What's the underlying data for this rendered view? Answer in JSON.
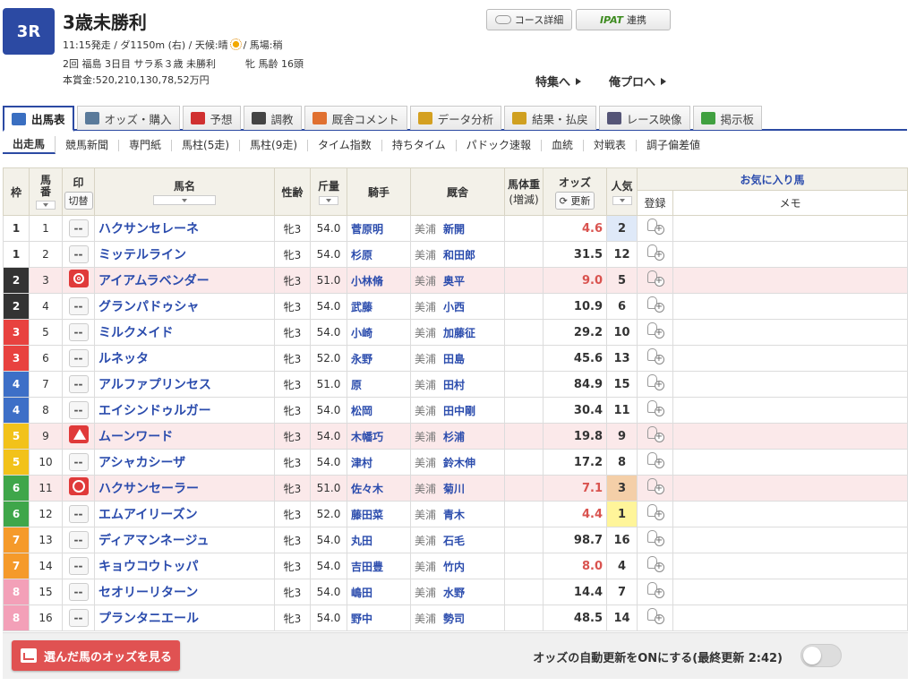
{
  "race": {
    "number": "3R",
    "title": "3歳未勝利",
    "info1_pre": "11:15発走 / ダ1150m (右) / 天候:晴",
    "info1_post": "/ 馬場:稍",
    "info2": "2回 福島 3日目 サラ系３歳 未勝利　　　牝 馬齢 16頭",
    "info3": "本賞金:520,210,130,78,52万円"
  },
  "header_buttons": {
    "course": "コース詳細",
    "ipat_logo": "IPAT",
    "ipat": "連携",
    "tokushu": "特集へ",
    "oreypro": "俺プロへ"
  },
  "tabs": [
    {
      "label": "出馬表",
      "icon": "table-icon",
      "color": "#3a6fc1"
    },
    {
      "label": "オッズ・購入",
      "icon": "odds-icon",
      "color": "#5a7a9a"
    },
    {
      "label": "予想",
      "icon": "target-icon",
      "color": "#d03030"
    },
    {
      "label": "調教",
      "icon": "stopwatch-icon",
      "color": "#444444"
    },
    {
      "label": "厩舎コメント",
      "icon": "barn-icon",
      "color": "#e07030"
    },
    {
      "label": "データ分析",
      "icon": "bar-chart-icon",
      "color": "#d4a020"
    },
    {
      "label": "結果・払戻",
      "icon": "coins-icon",
      "color": "#d0a020"
    },
    {
      "label": "レース映像",
      "icon": "video-icon",
      "color": "#555577"
    },
    {
      "label": "掲示板",
      "icon": "chat-icon",
      "color": "#40a040"
    }
  ],
  "subnav": [
    "出走馬",
    "競馬新聞",
    "専門紙",
    "馬柱(5走)",
    "馬柱(9走)",
    "タイム指数",
    "持ちタイム",
    "パドック速報",
    "血統",
    "対戦表",
    "調子偏差値"
  ],
  "columns": {
    "waku": "枠",
    "umaban": "馬番",
    "mark": "印",
    "mark_toggle": "切替",
    "name": "馬名",
    "sexage": "性齢",
    "weight": "斤量",
    "jockey": "騎手",
    "stable": "厩舎",
    "body": "馬体重",
    "body_sub": "(増減)",
    "odds": "オッズ",
    "odds_refresh": "更新",
    "ninki": "人気",
    "favorite": "お気に入り馬",
    "register": "登録",
    "memo": "メモ"
  },
  "waku_colors": {
    "1": {
      "bg": "#ffffff",
      "fg": "#333333"
    },
    "2": {
      "bg": "#333333",
      "fg": "#ffffff"
    },
    "3": {
      "bg": "#e8423f",
      "fg": "#ffffff"
    },
    "4": {
      "bg": "#3d6fc7",
      "fg": "#ffffff"
    },
    "5": {
      "bg": "#f2c21a",
      "fg": "#ffffff"
    },
    "6": {
      "bg": "#3fa64a",
      "fg": "#ffffff"
    },
    "7": {
      "bg": "#f59a2a",
      "fg": "#ffffff"
    },
    "8": {
      "bg": "#f3a0b8",
      "fg": "#ffffff"
    }
  },
  "horses": [
    {
      "waku": "1",
      "umaban": "1",
      "mark": "--",
      "name": "ハクサンセレーネ",
      "sexage": "牝3",
      "weight": "54.0",
      "jockey": "菅原明",
      "loc": "美浦",
      "trainer": "新開",
      "odds": "4.6",
      "hot": true,
      "ninki": "2",
      "highlight": false
    },
    {
      "waku": "1",
      "umaban": "2",
      "mark": "--",
      "name": "ミッテルライン",
      "sexage": "牝3",
      "weight": "54.0",
      "jockey": "杉原",
      "loc": "美浦",
      "trainer": "和田郎",
      "odds": "31.5",
      "hot": false,
      "ninki": "12",
      "highlight": false
    },
    {
      "waku": "2",
      "umaban": "3",
      "mark": "◎",
      "name": "アイアムラベンダー",
      "sexage": "牝3",
      "weight": "51.0",
      "jockey": "小林脩",
      "loc": "美浦",
      "trainer": "奥平",
      "odds": "9.0",
      "hot": true,
      "ninki": "5",
      "highlight": true
    },
    {
      "waku": "2",
      "umaban": "4",
      "mark": "--",
      "name": "グランパドゥシャ",
      "sexage": "牝3",
      "weight": "54.0",
      "jockey": "武藤",
      "loc": "美浦",
      "trainer": "小西",
      "odds": "10.9",
      "hot": false,
      "ninki": "6",
      "highlight": false
    },
    {
      "waku": "3",
      "umaban": "5",
      "mark": "--",
      "name": "ミルクメイド",
      "sexage": "牝3",
      "weight": "54.0",
      "jockey": "小崎",
      "loc": "美浦",
      "trainer": "加藤征",
      "odds": "29.2",
      "hot": false,
      "ninki": "10",
      "highlight": false
    },
    {
      "waku": "3",
      "umaban": "6",
      "mark": "--",
      "name": "ルネッタ",
      "sexage": "牝3",
      "weight": "52.0",
      "jockey": "永野",
      "loc": "美浦",
      "trainer": "田島",
      "odds": "45.6",
      "hot": false,
      "ninki": "13",
      "highlight": false
    },
    {
      "waku": "4",
      "umaban": "7",
      "mark": "--",
      "name": "アルファプリンセス",
      "sexage": "牝3",
      "weight": "51.0",
      "jockey": "原",
      "loc": "美浦",
      "trainer": "田村",
      "odds": "84.9",
      "hot": false,
      "ninki": "15",
      "highlight": false
    },
    {
      "waku": "4",
      "umaban": "8",
      "mark": "--",
      "name": "エイシンドゥルガー",
      "sexage": "牝3",
      "weight": "54.0",
      "jockey": "松岡",
      "loc": "美浦",
      "trainer": "田中剛",
      "odds": "30.4",
      "hot": false,
      "ninki": "11",
      "highlight": false
    },
    {
      "waku": "5",
      "umaban": "9",
      "mark": "▲",
      "name": "ムーンワード",
      "sexage": "牝3",
      "weight": "54.0",
      "jockey": "木幡巧",
      "loc": "美浦",
      "trainer": "杉浦",
      "odds": "19.8",
      "hot": false,
      "ninki": "9",
      "highlight": true
    },
    {
      "waku": "5",
      "umaban": "10",
      "mark": "--",
      "name": "アシャカシーザ",
      "sexage": "牝3",
      "weight": "54.0",
      "jockey": "津村",
      "loc": "美浦",
      "trainer": "鈴木伸",
      "odds": "17.2",
      "hot": false,
      "ninki": "8",
      "highlight": false
    },
    {
      "waku": "6",
      "umaban": "11",
      "mark": "○",
      "name": "ハクサンセーラー",
      "sexage": "牝3",
      "weight": "51.0",
      "jockey": "佐々木",
      "loc": "美浦",
      "trainer": "菊川",
      "odds": "7.1",
      "hot": true,
      "ninki": "3",
      "highlight": true
    },
    {
      "waku": "6",
      "umaban": "12",
      "mark": "--",
      "name": "エムアイリーズン",
      "sexage": "牝3",
      "weight": "52.0",
      "jockey": "藤田菜",
      "loc": "美浦",
      "trainer": "青木",
      "odds": "4.4",
      "hot": true,
      "ninki": "1",
      "highlight": false
    },
    {
      "waku": "7",
      "umaban": "13",
      "mark": "--",
      "name": "ディアマンネージュ",
      "sexage": "牝3",
      "weight": "54.0",
      "jockey": "丸田",
      "loc": "美浦",
      "trainer": "石毛",
      "odds": "98.7",
      "hot": false,
      "ninki": "16",
      "highlight": false
    },
    {
      "waku": "7",
      "umaban": "14",
      "mark": "--",
      "name": "キョウコウトッパ",
      "sexage": "牝3",
      "weight": "54.0",
      "jockey": "吉田豊",
      "loc": "美浦",
      "trainer": "竹内",
      "odds": "8.0",
      "hot": true,
      "ninki": "4",
      "highlight": false
    },
    {
      "waku": "8",
      "umaban": "15",
      "mark": "--",
      "name": "セオリーリターン",
      "sexage": "牝3",
      "weight": "54.0",
      "jockey": "嶋田",
      "loc": "美浦",
      "trainer": "水野",
      "odds": "14.4",
      "hot": false,
      "ninki": "7",
      "highlight": false
    },
    {
      "waku": "8",
      "umaban": "16",
      "mark": "--",
      "name": "プランタニエール",
      "sexage": "牝3",
      "weight": "54.0",
      "jockey": "野中",
      "loc": "美浦",
      "trainer": "勢司",
      "odds": "48.5",
      "hot": false,
      "ninki": "14",
      "highlight": false
    }
  ],
  "footer": {
    "odds_button": "選んだ馬のオッズを見る",
    "auto_update": "オッズの自動更新をONにする(最終更新 2:42)",
    "toggle_state": "off"
  }
}
